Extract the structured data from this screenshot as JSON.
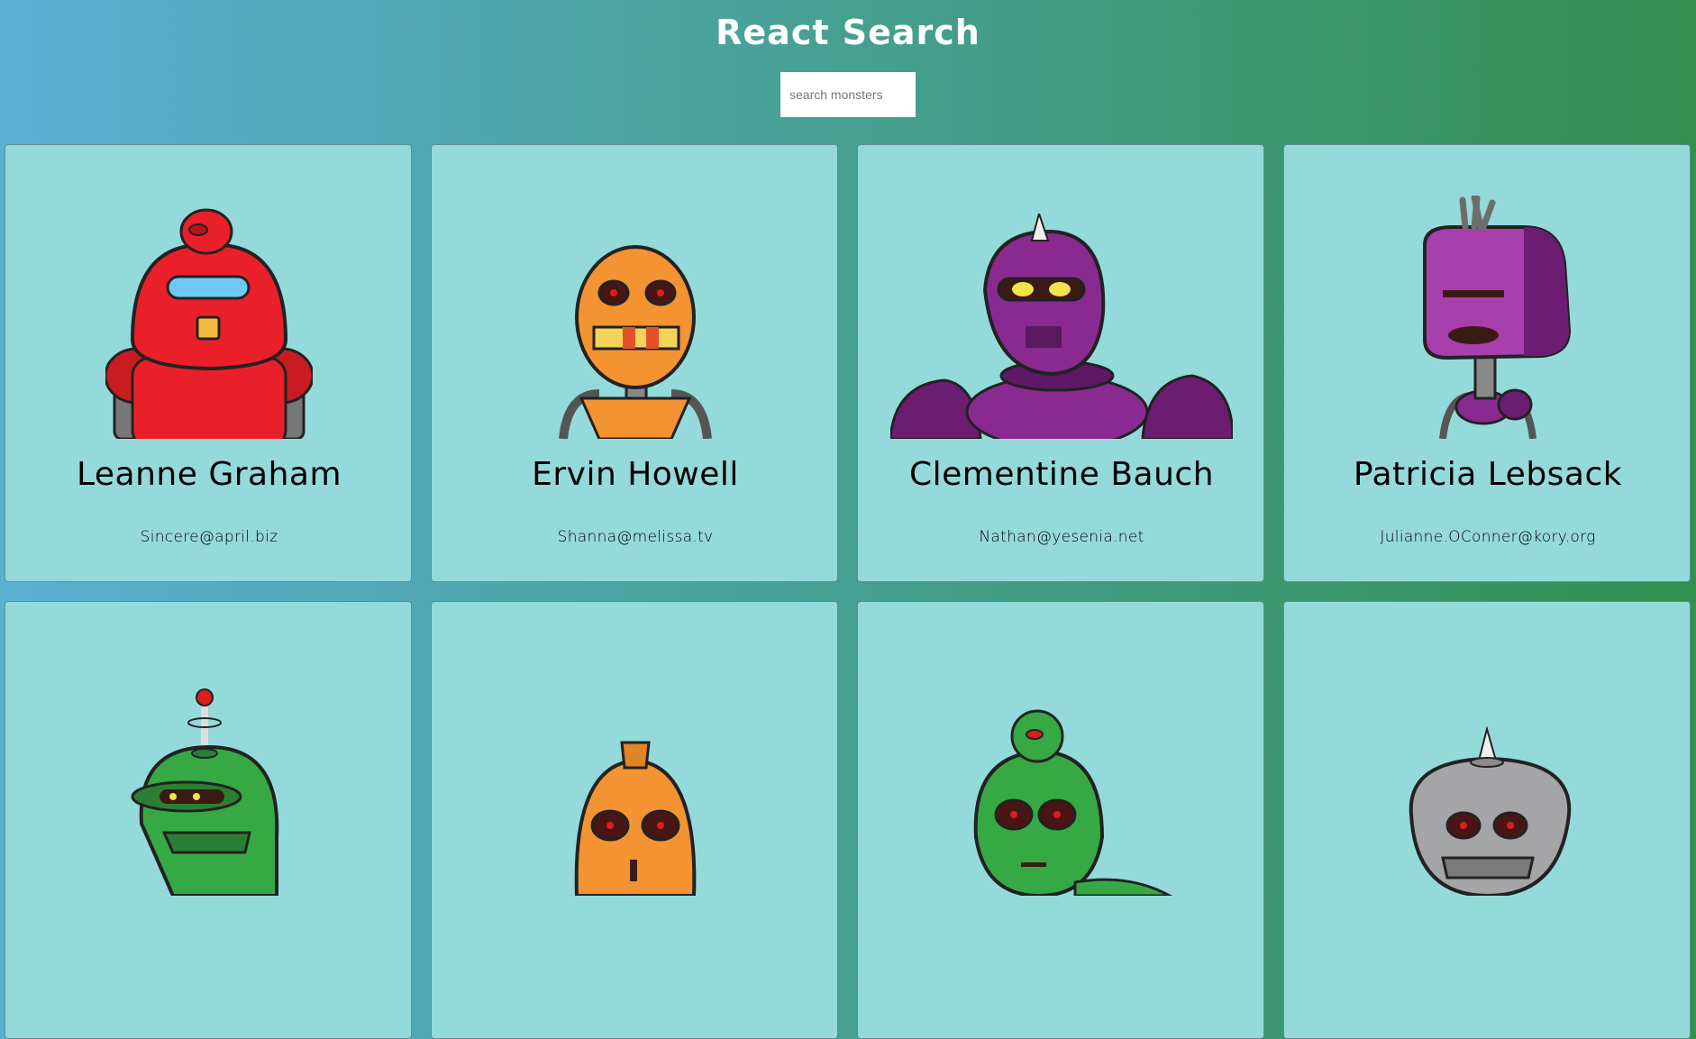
{
  "header": {
    "title": "React Search"
  },
  "search": {
    "placeholder": "search monsters",
    "value": ""
  },
  "monsters": [
    {
      "name": "Leanne Graham",
      "email": "Sincere@april.biz",
      "color": "#e9202a",
      "icon": "red-robot-avatar"
    },
    {
      "name": "Ervin Howell",
      "email": "Shanna@melissa.tv",
      "color": "#f39332",
      "icon": "orange-robot-avatar"
    },
    {
      "name": "Clementine Bauch",
      "email": "Nathan@yesenia.net",
      "color": "#8a2a90",
      "icon": "purple-robot-avatar"
    },
    {
      "name": "Patricia Lebsack",
      "email": "Julianne.OConner@kory.org",
      "color": "#8a2a90",
      "icon": "purple-boxhead-robot-avatar"
    },
    {
      "name": "",
      "email": "",
      "color": "#36a944",
      "icon": "green-robot-avatar"
    },
    {
      "name": "",
      "email": "",
      "color": "#f39332",
      "icon": "orange-robot-avatar"
    },
    {
      "name": "",
      "email": "",
      "color": "#36a944",
      "icon": "green-robot-avatar"
    },
    {
      "name": "",
      "email": "",
      "color": "#a5a5a8",
      "icon": "gray-robot-avatar"
    }
  ]
}
